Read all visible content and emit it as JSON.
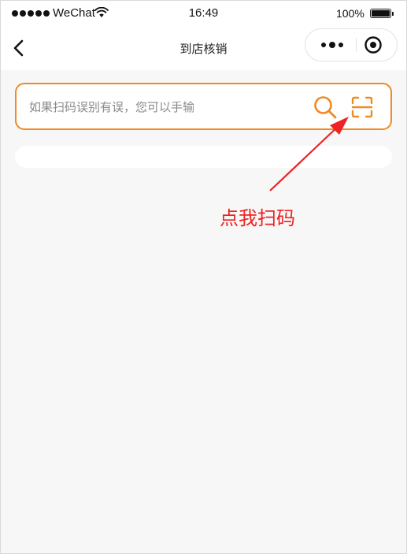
{
  "status_bar": {
    "carrier": "WeChat",
    "time": "16:49",
    "battery_percent": "100%",
    "signal_icon": "signal-dots-icon",
    "wifi_icon": "wifi-icon",
    "battery_icon": "battery-icon"
  },
  "nav": {
    "title": "到店核销",
    "back_icon": "chevron-left-icon",
    "more_icon": "more-dots-icon",
    "close_icon": "target-circle-icon"
  },
  "search": {
    "placeholder": "如果扫码误别有误，您可以手输",
    "value": "",
    "search_icon": "search-icon",
    "scan_icon": "scan-icon"
  },
  "annotation": {
    "text": "点我扫码",
    "color": "#ee2222"
  },
  "colors": {
    "accent": "#f08a24",
    "background": "#f7f7f7",
    "annotation_red": "#ee2222"
  }
}
